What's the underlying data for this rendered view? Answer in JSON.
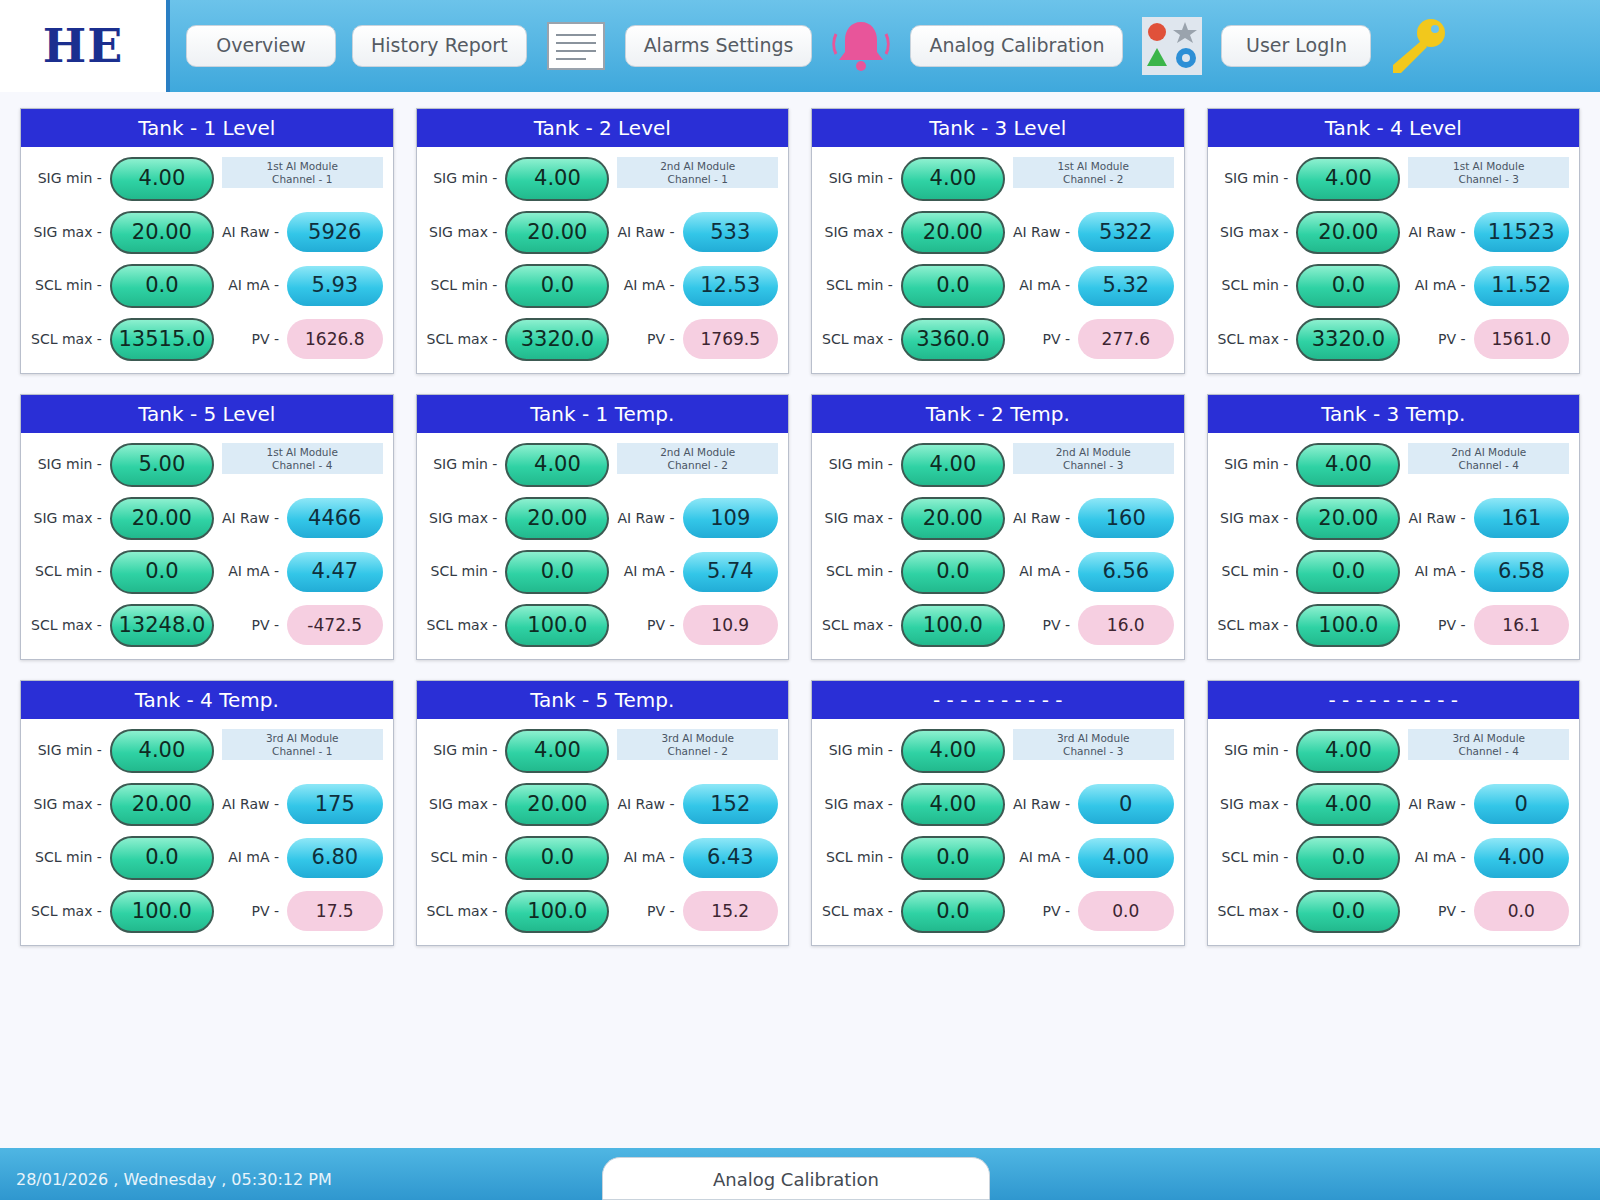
{
  "logo": "HE",
  "nav": [
    {
      "label": "Overview",
      "icon": "none"
    },
    {
      "label": "History Report",
      "icon": "list"
    },
    {
      "label": "Alarms Settings",
      "icon": "bell"
    },
    {
      "label": "Analog Calibration",
      "icon": "shapes"
    },
    {
      "label": "User LogIn",
      "icon": "key"
    }
  ],
  "labels": {
    "sig_min": "SIG min -",
    "sig_max": "SIG max -",
    "scl_min": "SCL min -",
    "scl_max": "SCL max -",
    "ai_raw": "AI Raw -",
    "ai_ma": "AI mA -",
    "pv": "PV -"
  },
  "panels": [
    {
      "title": "Tank - 1 Level",
      "module": [
        "1st AI Module",
        "Channel - 1"
      ],
      "sig_min": "4.00",
      "sig_max": "20.00",
      "scl_min": "0.0",
      "scl_max": "13515.0",
      "ai_raw": "5926",
      "ai_ma": "5.93",
      "pv": "1626.8"
    },
    {
      "title": "Tank - 2 Level",
      "module": [
        "2nd AI Module",
        "Channel - 1"
      ],
      "sig_min": "4.00",
      "sig_max": "20.00",
      "scl_min": "0.0",
      "scl_max": "3320.0",
      "ai_raw": "533",
      "ai_ma": "12.53",
      "pv": "1769.5"
    },
    {
      "title": "Tank - 3 Level",
      "module": [
        "1st AI Module",
        "Channel - 2"
      ],
      "sig_min": "4.00",
      "sig_max": "20.00",
      "scl_min": "0.0",
      "scl_max": "3360.0",
      "ai_raw": "5322",
      "ai_ma": "5.32",
      "pv": "277.6"
    },
    {
      "title": "Tank - 4 Level",
      "module": [
        "1st AI Module",
        "Channel - 3"
      ],
      "sig_min": "4.00",
      "sig_max": "20.00",
      "scl_min": "0.0",
      "scl_max": "3320.0",
      "ai_raw": "11523",
      "ai_ma": "11.52",
      "pv": "1561.0"
    },
    {
      "title": "Tank - 5 Level",
      "module": [
        "1st AI Module",
        "Channel - 4"
      ],
      "sig_min": "5.00",
      "sig_max": "20.00",
      "scl_min": "0.0",
      "scl_max": "13248.0",
      "ai_raw": "4466",
      "ai_ma": "4.47",
      "pv": "-472.5"
    },
    {
      "title": "Tank - 1 Temp.",
      "module": [
        "2nd AI Module",
        "Channel - 2"
      ],
      "sig_min": "4.00",
      "sig_max": "20.00",
      "scl_min": "0.0",
      "scl_max": "100.0",
      "ai_raw": "109",
      "ai_ma": "5.74",
      "pv": "10.9"
    },
    {
      "title": "Tank - 2 Temp.",
      "module": [
        "2nd AI Module",
        "Channel - 3"
      ],
      "sig_min": "4.00",
      "sig_max": "20.00",
      "scl_min": "0.0",
      "scl_max": "100.0",
      "ai_raw": "160",
      "ai_ma": "6.56",
      "pv": "16.0"
    },
    {
      "title": "Tank - 3 Temp.",
      "module": [
        "2nd AI Module",
        "Channel - 4"
      ],
      "sig_min": "4.00",
      "sig_max": "20.00",
      "scl_min": "0.0",
      "scl_max": "100.0",
      "ai_raw": "161",
      "ai_ma": "6.58",
      "pv": "16.1"
    },
    {
      "title": "Tank - 4 Temp.",
      "module": [
        "3rd AI Module",
        "Channel - 1"
      ],
      "sig_min": "4.00",
      "sig_max": "20.00",
      "scl_min": "0.0",
      "scl_max": "100.0",
      "ai_raw": "175",
      "ai_ma": "6.80",
      "pv": "17.5"
    },
    {
      "title": "Tank - 5 Temp.",
      "module": [
        "3rd AI Module",
        "Channel - 2"
      ],
      "sig_min": "4.00",
      "sig_max": "20.00",
      "scl_min": "0.0",
      "scl_max": "100.0",
      "ai_raw": "152",
      "ai_ma": "6.43",
      "pv": "15.2"
    },
    {
      "title": "- - - - - - - - - -",
      "module": [
        "3rd AI Module",
        "Channel - 3"
      ],
      "sig_min": "4.00",
      "sig_max": "4.00",
      "scl_min": "0.0",
      "scl_max": "0.0",
      "ai_raw": "0",
      "ai_ma": "4.00",
      "pv": "0.0"
    },
    {
      "title": "- - - - - - - - - -",
      "module": [
        "3rd AI Module",
        "Channel - 4"
      ],
      "sig_min": "4.00",
      "sig_max": "4.00",
      "scl_min": "0.0",
      "scl_max": "0.0",
      "ai_raw": "0",
      "ai_ma": "4.00",
      "pv": "0.0"
    }
  ],
  "status_bar": {
    "datetime": "28/01/2026 , Wednesday , 05:30:12 PM",
    "page": "Analog Calibration"
  }
}
